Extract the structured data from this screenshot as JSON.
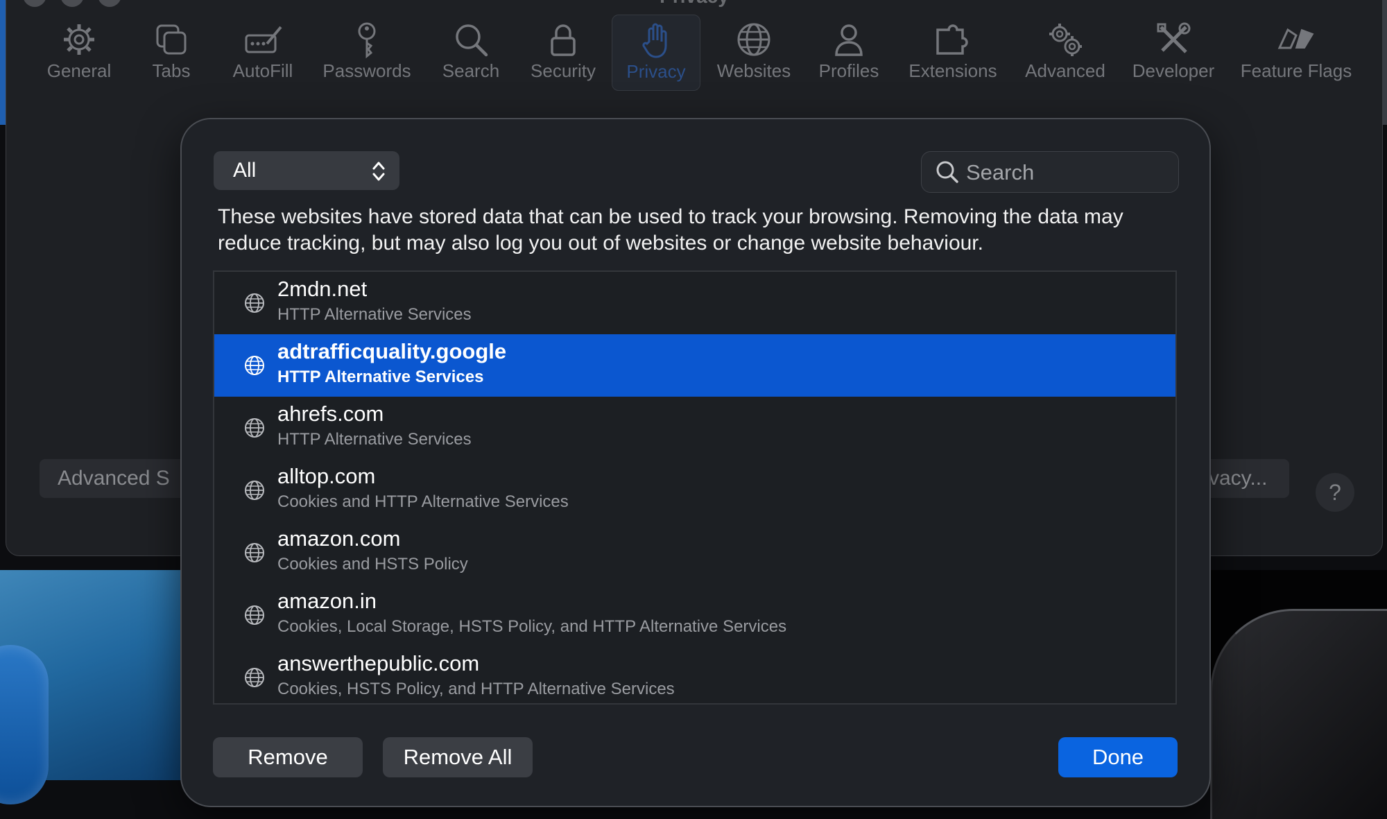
{
  "window": {
    "title": "Privacy"
  },
  "toolbar": {
    "items": [
      {
        "label": "General",
        "icon": "gear-icon"
      },
      {
        "label": "Tabs",
        "icon": "tabs-icon"
      },
      {
        "label": "AutoFill",
        "icon": "autofill-icon"
      },
      {
        "label": "Passwords",
        "icon": "key-icon"
      },
      {
        "label": "Search",
        "icon": "search-icon"
      },
      {
        "label": "Security",
        "icon": "lock-icon"
      },
      {
        "label": "Privacy",
        "icon": "hand-icon",
        "active": true
      },
      {
        "label": "Websites",
        "icon": "globe-icon"
      },
      {
        "label": "Profiles",
        "icon": "person-icon"
      },
      {
        "label": "Extensions",
        "icon": "puzzle-icon"
      },
      {
        "label": "Advanced",
        "icon": "gears-icon"
      },
      {
        "label": "Developer",
        "icon": "tools-icon"
      },
      {
        "label": "Feature Flags",
        "icon": "flags-icon"
      }
    ]
  },
  "background_buttons": {
    "advanced_settings": "Advanced S",
    "privacy_report": "vacy...",
    "help": "?"
  },
  "sheet": {
    "filter": {
      "selected": "All"
    },
    "search": {
      "placeholder": "Search"
    },
    "description": "These websites have stored data that can be used to track your browsing. Removing the data may reduce tracking, but may also log you out of websites or change website behaviour.",
    "sites": [
      {
        "name": "2mdn.net",
        "detail": "HTTP Alternative Services"
      },
      {
        "name": "adtrafficquality.google",
        "detail": "HTTP Alternative Services",
        "selected": true
      },
      {
        "name": "ahrefs.com",
        "detail": "HTTP Alternative Services"
      },
      {
        "name": "alltop.com",
        "detail": "Cookies and HTTP Alternative Services"
      },
      {
        "name": "amazon.com",
        "detail": "Cookies and HSTS Policy"
      },
      {
        "name": "amazon.in",
        "detail": "Cookies, Local Storage, HSTS Policy, and HTTP Alternative Services"
      },
      {
        "name": "answerthepublic.com",
        "detail": "Cookies, HSTS Policy, and HTTP Alternative Services"
      }
    ],
    "buttons": {
      "remove": "Remove",
      "remove_all": "Remove All",
      "done": "Done"
    }
  },
  "colors": {
    "selection": "#0b57d0",
    "done_button": "#0a64e0"
  }
}
